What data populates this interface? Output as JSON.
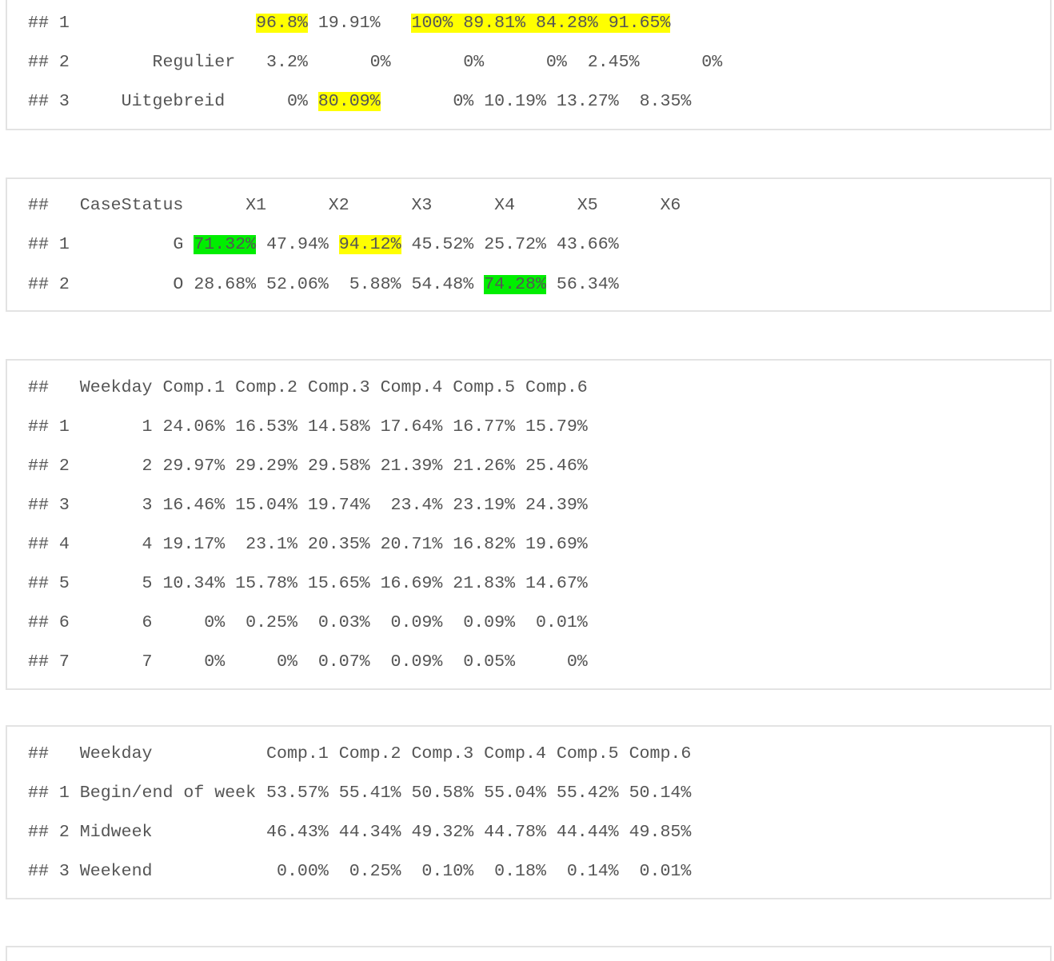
{
  "blocks": [
    {
      "name": "output-block-1",
      "lines": [
        [
          {
            "t": "## 1                  "
          },
          {
            "t": "96.8%",
            "hl": "yellow"
          },
          {
            "t": " 19.91%   "
          },
          {
            "t": "100% 89.81% 84.28% 91.65%",
            "hl": "yellow"
          }
        ],
        [
          {
            "t": "## 2        Regulier   3.2%      0%       0%      0%  2.45%      0%"
          }
        ],
        [
          {
            "t": "## 3     Uitgebreid      0% "
          },
          {
            "t": "80.09%",
            "hl": "yellow"
          },
          {
            "t": "       0% 10.19% 13.27%  8.35%"
          }
        ]
      ]
    },
    {
      "name": "output-block-2",
      "lines": [
        [
          {
            "t": "##   CaseStatus      X1      X2      X3      X4      X5      X6"
          }
        ],
        [
          {
            "t": "## 1          G "
          },
          {
            "t": "71.32%",
            "hl": "green"
          },
          {
            "t": " 47.94% "
          },
          {
            "t": "94.12%",
            "hl": "yellow"
          },
          {
            "t": " 45.52% 25.72% 43.66%"
          }
        ],
        [
          {
            "t": "## 2          O 28.68% 52.06%  5.88% 54.48% "
          },
          {
            "t": "74.28%",
            "hl": "green"
          },
          {
            "t": " 56.34%"
          }
        ]
      ]
    },
    {
      "name": "output-block-3",
      "lines": [
        [
          {
            "t": "##   Weekday Comp.1 Comp.2 Comp.3 Comp.4 Comp.5 Comp.6"
          }
        ],
        [
          {
            "t": "## 1       1 24.06% 16.53% 14.58% 17.64% 16.77% 15.79%"
          }
        ],
        [
          {
            "t": "## 2       2 29.97% 29.29% 29.58% 21.39% 21.26% 25.46%"
          }
        ],
        [
          {
            "t": "## 3       3 16.46% 15.04% 19.74%  23.4% 23.19% 24.39%"
          }
        ],
        [
          {
            "t": "## 4       4 19.17%  23.1% 20.35% 20.71% 16.82% 19.69%"
          }
        ],
        [
          {
            "t": "## 5       5 10.34% 15.78% 15.65% 16.69% 21.83% 14.67%"
          }
        ],
        [
          {
            "t": "## 6       6     0%  0.25%  0.03%  0.09%  0.09%  0.01%"
          }
        ],
        [
          {
            "t": "## 7       7     0%     0%  0.07%  0.09%  0.05%     0%"
          }
        ]
      ]
    },
    {
      "name": "output-block-4",
      "lines": [
        [
          {
            "t": "##   Weekday           Comp.1 Comp.2 Comp.3 Comp.4 Comp.5 Comp.6"
          }
        ],
        [
          {
            "t": "## 1 Begin/end of week 53.57% 55.41% 50.58% 55.04% 55.42% 50.14%"
          }
        ],
        [
          {
            "t": "## 2 Midweek           46.43% 44.34% 49.32% 44.78% 44.44% 49.85%"
          }
        ],
        [
          {
            "t": "## 3 Weekend            0.00%  0.25%  0.10%  0.18%  0.14%  0.01%"
          }
        ]
      ]
    },
    {
      "name": "output-block-5",
      "lines": []
    }
  ]
}
